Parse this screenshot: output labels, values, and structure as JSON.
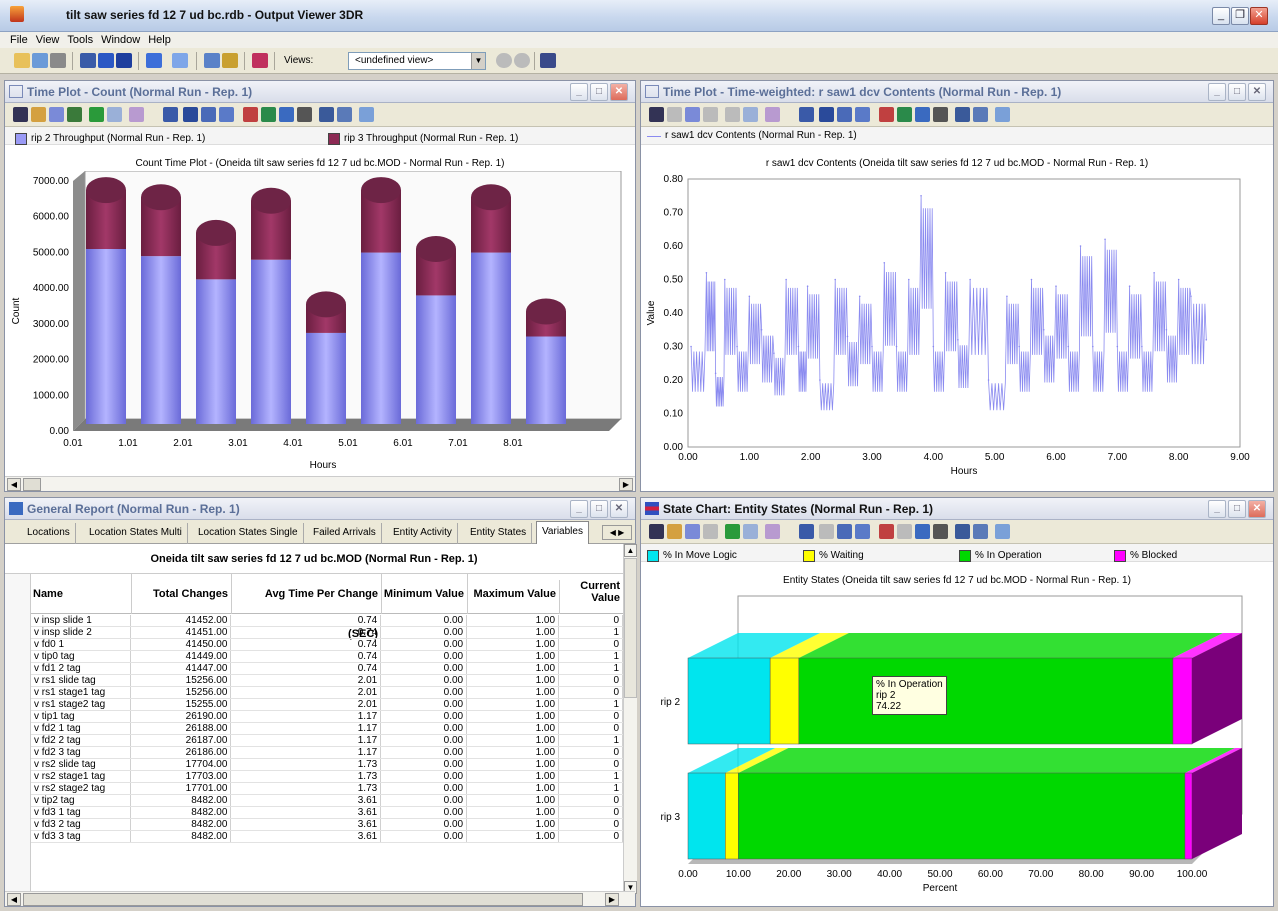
{
  "window": {
    "title": "tilt saw series fd 12 7 ud bc.rdb - Output Viewer 3DR"
  },
  "menu": [
    "File",
    "View",
    "Tools",
    "Window",
    "Help"
  ],
  "toolbar": {
    "views_label": "Views:",
    "views_value": "<undefined view>"
  },
  "panels": {
    "count": {
      "title": "Time Plot - Count (Normal Run - Rep. 1)"
    },
    "contents": {
      "title": "Time Plot - Time-weighted: r saw1 dcv Contents (Normal Run - Rep. 1)"
    },
    "report": {
      "title": "General Report (Normal Run - Rep. 1)"
    },
    "states": {
      "title": "State Chart: Entity States (Normal Run - Rep. 1)"
    }
  },
  "count_chart": {
    "chart_data": {
      "type": "bar",
      "title": "Count Time Plot - (Oneida tilt saw series fd 12 7 ud bc.MOD - Normal Run - Rep. 1)",
      "xlabel": "Hours",
      "ylabel": "Count",
      "categories": [
        "0.01",
        "1.01",
        "2.01",
        "3.01",
        "4.01",
        "5.01",
        "6.01",
        "7.01",
        "8.01"
      ],
      "yticks": [
        "0.00",
        "1000.00",
        "2000.00",
        "3000.00",
        "4000.00",
        "5000.00",
        "6000.00",
        "7000.00"
      ],
      "ylim": [
        0,
        7000
      ],
      "series": [
        {
          "name": "rip 2 Throughput (Normal Run - Rep. 1)",
          "color": "#9a9af5",
          "values": [
            4900,
            4700,
            4050,
            4600,
            2550,
            4800,
            3600,
            4800,
            2450
          ]
        },
        {
          "name": "rip 3 Throughput (Normal Run - Rep. 1)",
          "color": "#8c2a54",
          "values": [
            1650,
            1650,
            1300,
            1650,
            800,
            1750,
            1300,
            1550,
            700
          ]
        }
      ]
    }
  },
  "contents_chart": {
    "chart_data": {
      "type": "line",
      "title": "r saw1 dcv Contents (Oneida tilt saw series fd 12 7 ud bc.MOD - Normal Run - Rep. 1)",
      "xlabel": "Hours",
      "ylabel": "Value",
      "xlim": [
        0,
        9
      ],
      "ylim": [
        0,
        0.8
      ],
      "xticks": [
        "0.00",
        "1.00",
        "2.00",
        "3.00",
        "4.00",
        "5.00",
        "6.00",
        "7.00",
        "8.00",
        "9.00"
      ],
      "yticks": [
        "0.00",
        "0.10",
        "0.20",
        "0.30",
        "0.40",
        "0.50",
        "0.60",
        "0.70",
        "0.80"
      ],
      "series": [
        {
          "name": "r saw1 dcv Contents (Normal Run - Rep. 1)",
          "color": "#8a8af0",
          "x": [
            0.05,
            0.3,
            0.45,
            0.6,
            0.8,
            1.0,
            1.2,
            1.4,
            1.6,
            1.8,
            1.95,
            2.15,
            2.4,
            2.6,
            2.8,
            3.0,
            3.2,
            3.4,
            3.6,
            3.8,
            4.0,
            4.2,
            4.4,
            4.6,
            4.9,
            5.2,
            5.4,
            5.6,
            5.8,
            6.0,
            6.2,
            6.4,
            6.6,
            6.8,
            7.0,
            7.2,
            7.4,
            7.6,
            7.8,
            8.0,
            8.2,
            8.45
          ],
          "y": [
            0.3,
            0.52,
            0.22,
            0.5,
            0.3,
            0.45,
            0.35,
            0.28,
            0.5,
            0.3,
            0.48,
            0.2,
            0.5,
            0.33,
            0.45,
            0.3,
            0.55,
            0.3,
            0.5,
            0.75,
            0.3,
            0.52,
            0.32,
            0.5,
            0.2,
            0.45,
            0.3,
            0.5,
            0.35,
            0.48,
            0.3,
            0.6,
            0.3,
            0.62,
            0.3,
            0.48,
            0.3,
            0.52,
            0.35,
            0.5,
            0.45,
            0.32
          ]
        }
      ]
    }
  },
  "report": {
    "tabs": [
      "Locations",
      "Location States Multi",
      "Location States Single",
      "Failed Arrivals",
      "Entity Activity",
      "Entity States",
      "Variables"
    ],
    "header": "Oneida tilt saw series fd 12 7 ud bc.MOD (Normal Run - Rep. 1)",
    "columns": [
      "Name",
      "Total Changes",
      "Avg Time Per Change (SEC)",
      "Minimum Value",
      "Maximum Value",
      "Current Value"
    ],
    "rows": [
      [
        "v insp slide 1",
        "41452.00",
        "0.74",
        "0.00",
        "1.00",
        "0"
      ],
      [
        "v insp slide 2",
        "41451.00",
        "0.74",
        "0.00",
        "1.00",
        "1"
      ],
      [
        "v fd0 1",
        "41450.00",
        "0.74",
        "0.00",
        "1.00",
        "0"
      ],
      [
        "v tip0 tag",
        "41449.00",
        "0.74",
        "0.00",
        "1.00",
        "1"
      ],
      [
        "v fd1 2 tag",
        "41447.00",
        "0.74",
        "0.00",
        "1.00",
        "1"
      ],
      [
        "v rs1 slide tag",
        "15256.00",
        "2.01",
        "0.00",
        "1.00",
        "0"
      ],
      [
        "v rs1 stage1 tag",
        "15256.00",
        "2.01",
        "0.00",
        "1.00",
        "0"
      ],
      [
        "v rs1 stage2 tag",
        "15255.00",
        "2.01",
        "0.00",
        "1.00",
        "1"
      ],
      [
        "v tip1 tag",
        "26190.00",
        "1.17",
        "0.00",
        "1.00",
        "0"
      ],
      [
        "v fd2 1 tag",
        "26188.00",
        "1.17",
        "0.00",
        "1.00",
        "0"
      ],
      [
        "v fd2 2 tag",
        "26187.00",
        "1.17",
        "0.00",
        "1.00",
        "1"
      ],
      [
        "v fd2 3 tag",
        "26186.00",
        "1.17",
        "0.00",
        "1.00",
        "0"
      ],
      [
        "v rs2 slide tag",
        "17704.00",
        "1.73",
        "0.00",
        "1.00",
        "0"
      ],
      [
        "v rs2 stage1 tag",
        "17703.00",
        "1.73",
        "0.00",
        "1.00",
        "1"
      ],
      [
        "v rs2 stage2 tag",
        "17701.00",
        "1.73",
        "0.00",
        "1.00",
        "1"
      ],
      [
        "v tip2 tag",
        "8482.00",
        "3.61",
        "0.00",
        "1.00",
        "0"
      ],
      [
        "v fd3 1 tag",
        "8482.00",
        "3.61",
        "0.00",
        "1.00",
        "0"
      ],
      [
        "v fd3 2 tag",
        "8482.00",
        "3.61",
        "0.00",
        "1.00",
        "0"
      ],
      [
        "v fd3 3 tag",
        "8482.00",
        "3.61",
        "0.00",
        "1.00",
        "0"
      ]
    ]
  },
  "states_chart": {
    "chart_data": {
      "type": "bar",
      "title": "Entity States (Oneida tilt saw series fd 12 7 ud bc.MOD - Normal Run - Rep. 1)",
      "xlabel": "Percent",
      "categories": [
        "rip 2",
        "rip 3"
      ],
      "xlim": [
        0,
        100
      ],
      "xticks": [
        "0.00",
        "10.00",
        "20.00",
        "30.00",
        "40.00",
        "50.00",
        "60.00",
        "70.00",
        "80.00",
        "90.00",
        "100.00"
      ],
      "series": [
        {
          "name": "% In Move Logic",
          "color": "#00e5ee",
          "values": [
            16.3,
            7.4
          ]
        },
        {
          "name": "% Waiting",
          "color": "#ffff00",
          "values": [
            5.7,
            2.6
          ]
        },
        {
          "name": "% In Operation",
          "color": "#00d800",
          "values": [
            74.22,
            88.6
          ]
        },
        {
          "name": "% Blocked",
          "color": "#ff00ff",
          "values": [
            3.78,
            1.4
          ]
        }
      ],
      "tooltip": {
        "series": "% In Operation",
        "category": "rip 2",
        "value": "74.22"
      }
    }
  }
}
